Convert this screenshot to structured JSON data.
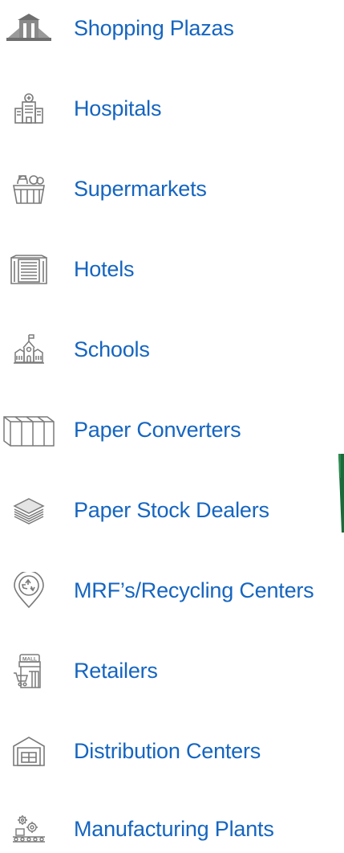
{
  "colors": {
    "label": "#1565c0",
    "icon_stroke": "#7a7a7a",
    "accent_green": "#1b6b3a"
  },
  "items": [
    {
      "label": "Shopping Plazas",
      "icon": "shopping-plaza-icon"
    },
    {
      "label": "Hospitals",
      "icon": "hospital-icon"
    },
    {
      "label": "Supermarkets",
      "icon": "supermarket-basket-icon"
    },
    {
      "label": "Hotels",
      "icon": "hotel-building-icon"
    },
    {
      "label": "Schools",
      "icon": "school-icon"
    },
    {
      "label": "Paper Converters",
      "icon": "paper-converter-icon"
    },
    {
      "label": "Paper Stock Dealers",
      "icon": "paper-stack-layers-icon"
    },
    {
      "label": "MRF’s/Recycling Centers",
      "icon": "recycling-location-pin-icon"
    },
    {
      "label": "Retailers",
      "icon": "mall-cart-icon"
    },
    {
      "label": "Distribution Centers",
      "icon": "warehouse-icon"
    },
    {
      "label": "Manufacturing Plants",
      "icon": "manufacturing-gears-conveyor-icon"
    }
  ]
}
